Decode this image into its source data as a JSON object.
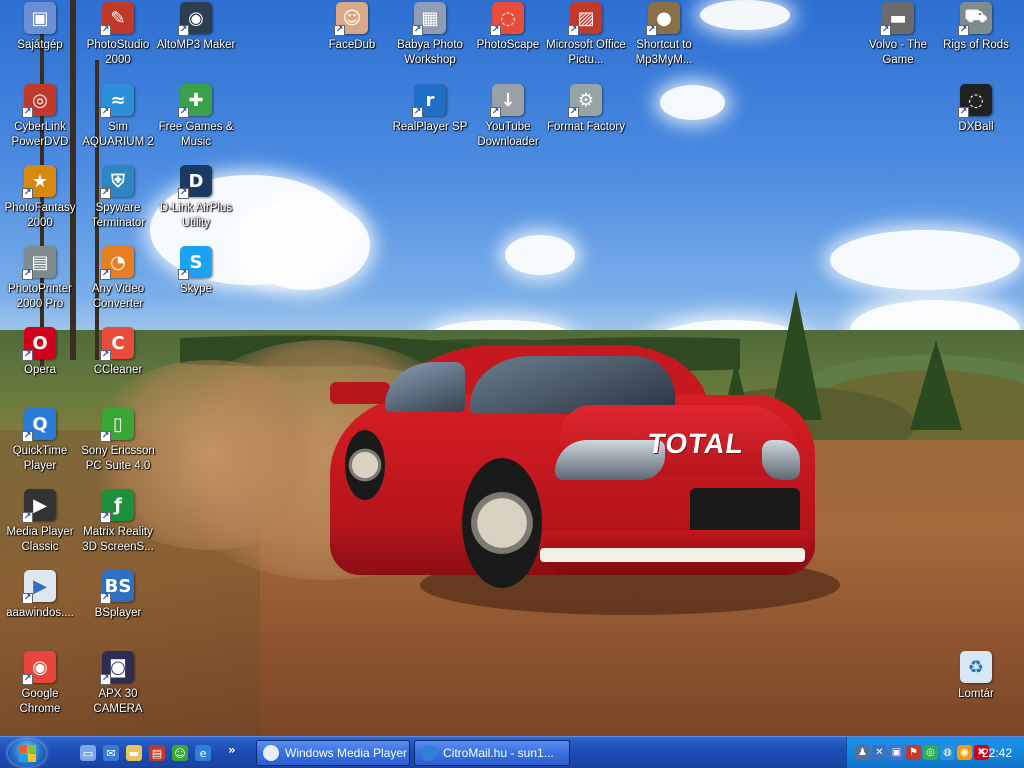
{
  "desktop": {
    "icons": [
      {
        "label": "Sajátgép",
        "icon": "computer-icon",
        "color": "#6c8fd4",
        "glyph": "▣",
        "shortcut": false
      },
      {
        "label": "PhotoStudio 2000",
        "icon": "photostudio-icon",
        "color": "#c0392b",
        "glyph": "✎",
        "shortcut": true
      },
      {
        "label": "AltoMP3 Maker",
        "icon": "altomp3-icon",
        "color": "#2c3e50",
        "glyph": "◉",
        "shortcut": true
      },
      {
        "label": "FaceDub",
        "icon": "facedub-icon",
        "color": "#d9a884",
        "glyph": "☺",
        "shortcut": true
      },
      {
        "label": "Babya Photo Workshop",
        "icon": "babya-photo-icon",
        "color": "#8e9db5",
        "glyph": "▦",
        "shortcut": true
      },
      {
        "label": "PhotoScape",
        "icon": "photoscape-icon",
        "color": "#e74c3c",
        "glyph": "◌",
        "shortcut": true
      },
      {
        "label": "Microsoft Office Pictu...",
        "icon": "office-picture-icon",
        "color": "#c0392b",
        "glyph": "▨",
        "shortcut": true
      },
      {
        "label": "Shortcut to Mp3MyM...",
        "icon": "mp3mym-icon",
        "color": "#8b6f47",
        "glyph": "●",
        "shortcut": true
      },
      {
        "label": "Volvo - The Game",
        "icon": "volvo-game-icon",
        "color": "#6b6b6b",
        "glyph": "▬",
        "shortcut": true
      },
      {
        "label": "Rigs of Rods",
        "icon": "rigs-of-rods-icon",
        "color": "#7f8c8d",
        "glyph": "⛟",
        "shortcut": true
      },
      {
        "label": "CyberLink PowerDVD",
        "icon": "powerdvd-icon",
        "color": "#c0392b",
        "glyph": "◎",
        "shortcut": true
      },
      {
        "label": "Sim AQUARIUM 2",
        "icon": "sim-aquarium-icon",
        "color": "#2d8fd8",
        "glyph": "≈",
        "shortcut": true
      },
      {
        "label": "Free Games & Music",
        "icon": "gift-icon",
        "color": "#3ba04a",
        "glyph": "✚",
        "shortcut": true
      },
      {
        "label": "RealPlayer SP",
        "icon": "realplayer-icon",
        "color": "#1f6fc6",
        "glyph": "r",
        "shortcut": true
      },
      {
        "label": "YouTube Downloader",
        "icon": "youtube-downloader-icon",
        "color": "#9aa0a6",
        "glyph": "↓",
        "shortcut": true
      },
      {
        "label": "Format Factory",
        "icon": "format-factory-icon",
        "color": "#95a5a6",
        "glyph": "⚙",
        "shortcut": true
      },
      {
        "label": "DXBall",
        "icon": "dxball-icon",
        "color": "#222222",
        "glyph": "◌",
        "shortcut": true
      },
      {
        "label": "PhotoFantasy 2000",
        "icon": "photofantasy-icon",
        "color": "#d68910",
        "glyph": "★",
        "shortcut": true
      },
      {
        "label": "Spyware Terminator",
        "icon": "spyware-terminator-icon",
        "color": "#2e86c1",
        "glyph": "⛨",
        "shortcut": true
      },
      {
        "label": "D-Link AirPlus Utility",
        "icon": "dlink-icon",
        "color": "#1b3a63",
        "glyph": "D",
        "shortcut": true
      },
      {
        "label": "PhotoPrinter 2000 Pro",
        "icon": "photoprinter-icon",
        "color": "#7f8c8d",
        "glyph": "▤",
        "shortcut": true
      },
      {
        "label": "Any Video Converter",
        "icon": "any-video-converter-icon",
        "color": "#e67e22",
        "glyph": "◔",
        "shortcut": true
      },
      {
        "label": "Skype",
        "icon": "skype-icon",
        "color": "#1da1f2",
        "glyph": "S",
        "shortcut": true
      },
      {
        "label": "Opera",
        "icon": "opera-icon",
        "color": "#d0021b",
        "glyph": "O",
        "shortcut": true
      },
      {
        "label": "CCleaner",
        "icon": "ccleaner-icon",
        "color": "#e74c3c",
        "glyph": "C",
        "shortcut": true
      },
      {
        "label": "QuickTime Player",
        "icon": "quicktime-icon",
        "color": "#2b7bd6",
        "glyph": "Q",
        "shortcut": true
      },
      {
        "label": "Sony Ericsson PC Suite 4.0",
        "icon": "sony-ericsson-icon",
        "color": "#3aa635",
        "glyph": "▯",
        "shortcut": true
      },
      {
        "label": "Media Player Classic",
        "icon": "media-player-classic-icon",
        "color": "#333333",
        "glyph": "▶",
        "shortcut": true
      },
      {
        "label": "Matrix Reality 3D ScreenS...",
        "icon": "matrix-reality-icon",
        "color": "#1e8f3a",
        "glyph": "ƒ",
        "shortcut": true
      },
      {
        "label": "aaawindos....",
        "icon": "media-file-icon",
        "color": "#dfe6ee",
        "glyph": "▶",
        "shortcut": true
      },
      {
        "label": "BSplayer",
        "icon": "bsplayer-icon",
        "color": "#2f6fc2",
        "glyph": "BS",
        "shortcut": true
      },
      {
        "label": "Google Chrome",
        "icon": "chrome-icon",
        "color": "#e8453c",
        "glyph": "◉",
        "shortcut": true
      },
      {
        "label": "APX 30 CAMERA",
        "icon": "camera-icon",
        "color": "#2c2c54",
        "glyph": "◙",
        "shortcut": true
      },
      {
        "label": "Lomtár",
        "icon": "recycle-bin-icon",
        "color": "#d7e8f5",
        "glyph": "♻",
        "shortcut": false
      }
    ]
  },
  "taskbar": {
    "quick_launch": [
      {
        "icon": "show-desktop-icon",
        "color": "#7fa7e6",
        "glyph": "▭"
      },
      {
        "icon": "outlook-icon",
        "color": "#3b7bd6",
        "glyph": "✉"
      },
      {
        "icon": "folder-icon",
        "color": "#e8c35a",
        "glyph": "▬"
      },
      {
        "icon": "acrobat-icon",
        "color": "#c0392b",
        "glyph": "▤"
      },
      {
        "icon": "messenger-icon",
        "color": "#3aa635",
        "glyph": "☺"
      },
      {
        "icon": "internet-explorer-icon",
        "color": "#2f7fd8",
        "glyph": "e"
      }
    ],
    "more_label": "»",
    "tasks": [
      {
        "label": "Windows Media Player",
        "icon": "windows-media-player-icon",
        "color": "#e8eef6"
      },
      {
        "label": "CitroMail.hu - sun1...",
        "icon": "internet-explorer-icon",
        "color": "#2f7fd8"
      }
    ],
    "tray": [
      {
        "icon": "users-icon",
        "color": "#5a6f8c",
        "glyph": "♟"
      },
      {
        "icon": "network-icon",
        "color": "#3b6fc2",
        "glyph": "✕"
      },
      {
        "icon": "display-icon",
        "color": "#4a6fd0",
        "glyph": "▣"
      },
      {
        "icon": "flag-icon",
        "color": "#c0392b",
        "glyph": "⚑"
      },
      {
        "icon": "green-tray-icon",
        "color": "#2fae4f",
        "glyph": "◎"
      },
      {
        "icon": "blue-tray-icon",
        "color": "#2a8fd8",
        "glyph": "◍"
      },
      {
        "icon": "media-tray-icon",
        "color": "#f39c12",
        "glyph": "◉"
      },
      {
        "icon": "red-tray-icon",
        "color": "#d0021b",
        "glyph": "✖"
      }
    ],
    "clock": "22:42"
  }
}
